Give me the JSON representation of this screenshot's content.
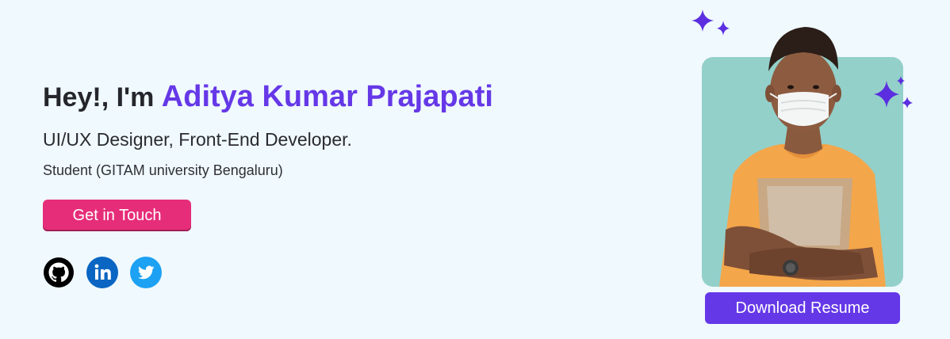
{
  "hero": {
    "greeting": "Hey!, I'm ",
    "name": "Aditya Kumar Prajapati",
    "roles": "UI/UX Designer, Front-End Developer.",
    "education": "Student (GITAM university Bengaluru)",
    "cta_label": "Get in Touch"
  },
  "socials": [
    {
      "name": "github",
      "icon": "github-icon",
      "color": "#000000"
    },
    {
      "name": "linkedin",
      "icon": "linkedin-icon",
      "color": "#0a66c2"
    },
    {
      "name": "twitter",
      "icon": "twitter-icon",
      "color": "#1da1f2"
    }
  ],
  "profile": {
    "download_label": "Download Resume"
  },
  "colors": {
    "background": "#f0f9fe",
    "accent": "#6538e7",
    "cta": "#e62d79",
    "photo_bg": "#93d0ca",
    "sparkle": "#5b2fe0"
  }
}
